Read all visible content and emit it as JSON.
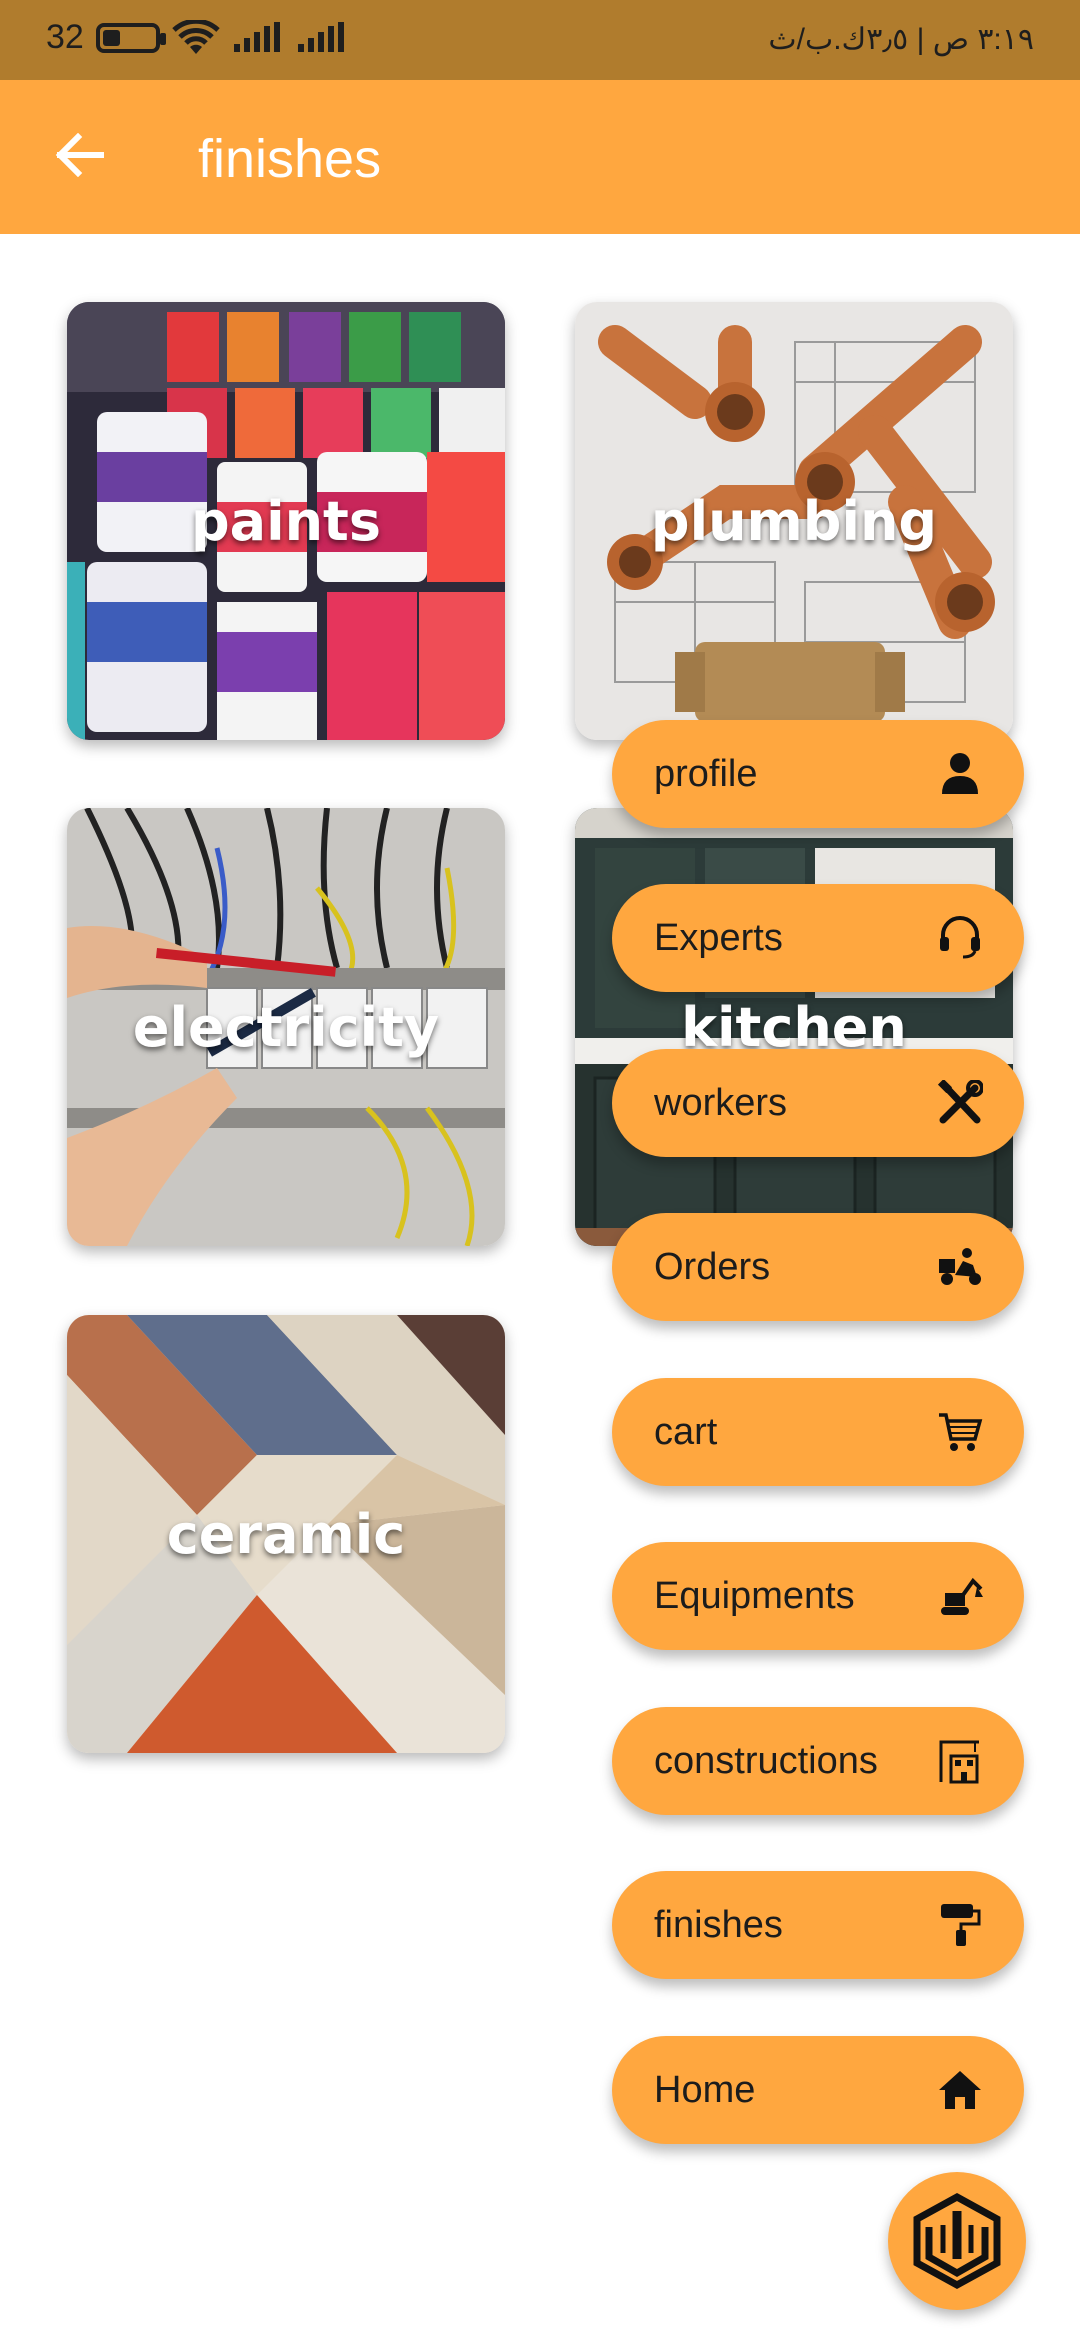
{
  "status_bar": {
    "battery_percent": "32",
    "battery_level": 0.32,
    "time_text": "٣:١٩ ص | ٣٫٥ك.ب/ث"
  },
  "app_bar": {
    "title": "finishes",
    "back_icon": "arrow-left-icon",
    "background": "#FFA73F"
  },
  "categories": [
    {
      "label": "paints",
      "icon": "paint-cans-image"
    },
    {
      "label": "plumbing",
      "icon": "copper-pipes-image"
    },
    {
      "label": "electricity",
      "icon": "electrical-panel-image"
    },
    {
      "label": "kitchen",
      "icon": "kitchen-image"
    },
    {
      "label": "ceramic",
      "icon": "ceramic-tiles-image"
    }
  ],
  "menu": [
    {
      "label": "profile",
      "icon": "person-icon"
    },
    {
      "label": "Experts",
      "icon": "headset-icon"
    },
    {
      "label": "workers",
      "icon": "tools-icon"
    },
    {
      "label": "Orders",
      "icon": "delivery-scooter-icon"
    },
    {
      "label": "cart",
      "icon": "cart-icon"
    },
    {
      "label": "Equipments",
      "icon": "excavator-icon"
    },
    {
      "label": "constructions",
      "icon": "crane-building-icon"
    },
    {
      "label": "finishes",
      "icon": "paint-roller-icon"
    },
    {
      "label": "Home",
      "icon": "home-icon"
    }
  ],
  "fab": {
    "icon": "app-logo-icon"
  },
  "colors": {
    "accent": "#FFA73F",
    "status_bar": "#B07C2D"
  }
}
